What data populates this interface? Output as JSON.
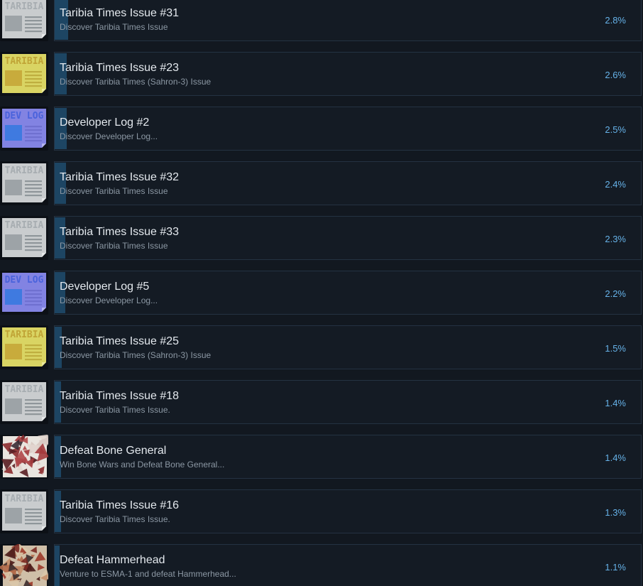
{
  "achievements": [
    {
      "title": "Taribia Times Issue #31",
      "description": "Discover Taribia Times Issue",
      "percent": "2.8%",
      "icon": "taribia-gray-newspaper-icon",
      "icon_label": "TARIBIA",
      "icon_variant": "gray"
    },
    {
      "title": "Taribia Times Issue #23",
      "description": "Discover Taribia Times (Sahron-3) Issue",
      "percent": "2.6%",
      "icon": "taribia-yellow-newspaper-icon",
      "icon_label": "TARIBIA",
      "icon_variant": "yellow"
    },
    {
      "title": "Developer Log #2",
      "description": "Discover Developer Log...",
      "percent": "2.5%",
      "icon": "dev-log-newspaper-icon",
      "icon_label": "DEV LOG",
      "icon_variant": "blue"
    },
    {
      "title": "Taribia Times Issue #32",
      "description": "Discover Taribia Times Issue",
      "percent": "2.4%",
      "icon": "taribia-gray-newspaper-icon",
      "icon_label": "TARIBIA",
      "icon_variant": "gray"
    },
    {
      "title": "Taribia Times Issue #33",
      "description": "Discover Taribia Times Issue",
      "percent": "2.3%",
      "icon": "taribia-gray-newspaper-icon",
      "icon_label": "TARIBIA",
      "icon_variant": "gray"
    },
    {
      "title": "Developer Log #5",
      "description": "Discover Developer Log...",
      "percent": "2.2%",
      "icon": "dev-log-newspaper-icon",
      "icon_label": "DEV LOG",
      "icon_variant": "blue"
    },
    {
      "title": "Taribia Times Issue #25",
      "description": "Discover Taribia Times (Sahron-3) Issue",
      "percent": "1.5%",
      "icon": "taribia-yellow-newspaper-icon",
      "icon_label": "TARIBIA",
      "icon_variant": "yellow"
    },
    {
      "title": "Taribia Times Issue #18",
      "description": "Discover Taribia Times Issue.",
      "percent": "1.4%",
      "icon": "taribia-gray-newspaper-icon",
      "icon_label": "TARIBIA",
      "icon_variant": "gray"
    },
    {
      "title": "Defeat Bone General",
      "description": "Win Bone Wars and Defeat Bone General...",
      "percent": "1.4%",
      "icon": "bone-general-art-icon",
      "icon_label": "",
      "icon_variant": "art-bone"
    },
    {
      "title": "Taribia Times Issue #16",
      "description": "Discover Taribia Times Issue.",
      "percent": "1.3%",
      "icon": "taribia-gray-newspaper-icon",
      "icon_label": "TARIBIA",
      "icon_variant": "gray"
    },
    {
      "title": "Defeat Hammerhead",
      "description": "Venture to ESMA-1 and defeat Hammerhead...",
      "percent": "1.1%",
      "icon": "hammerhead-art-icon",
      "icon_label": "",
      "icon_variant": "art-hammer"
    }
  ],
  "colors": {
    "background": "#121820",
    "panel": "#141b24",
    "panel_border": "#243242",
    "progress_bar": "#1d4563",
    "title_text": "#e4e9ee",
    "description_text": "#8c98a4",
    "percent_text": "#66b2e8"
  }
}
